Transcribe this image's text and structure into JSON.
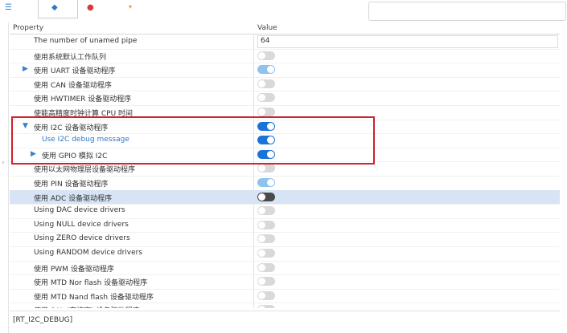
{
  "colors": {
    "accent": "#1a73d9",
    "selected_row": "#d6e4f5",
    "highlight_border": "#d0202a"
  },
  "toolbar": {
    "tabs": [
      {
        "icon": "list-icon"
      },
      {
        "icon": "shield-icon"
      },
      {
        "icon": "palette-icon"
      },
      {
        "icon": "bookmark-icon"
      }
    ],
    "search": {
      "placeholder": ""
    }
  },
  "table": {
    "headers": {
      "property": "Property",
      "value": "Value"
    },
    "rows": [
      {
        "label": "The number of unamed pipe",
        "type": "text",
        "value": "64"
      },
      {
        "label": "使用系统默认工作队列",
        "type": "toggle",
        "state": "off"
      },
      {
        "label": "使用 UART 设备驱动程序",
        "type": "toggle",
        "state": "on-light",
        "expander": true
      },
      {
        "label": "使用 CAN 设备驱动程序",
        "type": "toggle",
        "state": "off"
      },
      {
        "label": "使用 HWTIMER 设备驱动程序",
        "type": "toggle",
        "state": "off"
      },
      {
        "label": "使能高精度时钟计算 CPU 时间",
        "type": "toggle",
        "state": "off"
      },
      {
        "label": "使用 I2C 设备驱动程序",
        "type": "toggle",
        "state": "on",
        "expander": "open"
      },
      {
        "label": "Use I2C debug message",
        "type": "toggle",
        "state": "on",
        "child": true,
        "blue": true
      },
      {
        "label": "使用 GPIO 模拟 I2C",
        "type": "toggle",
        "state": "on",
        "child": true,
        "expander": true
      },
      {
        "label": "使用以太网物理层设备驱动程序",
        "type": "toggle",
        "state": "off"
      },
      {
        "label": "使用 PIN 设备驱动程序",
        "type": "toggle",
        "state": "on-light"
      },
      {
        "label": "使用 ADC 设备驱动程序",
        "type": "toggle",
        "state": "off-dark",
        "selected": true
      },
      {
        "label": "Using DAC device drivers",
        "type": "toggle",
        "state": "off"
      },
      {
        "label": "Using NULL device drivers",
        "type": "toggle",
        "state": "off"
      },
      {
        "label": "Using ZERO device drivers",
        "type": "toggle",
        "state": "off"
      },
      {
        "label": "Using RANDOM device drivers",
        "type": "toggle",
        "state": "off"
      },
      {
        "label": "使用 PWM 设备驱动程序",
        "type": "toggle",
        "state": "off"
      },
      {
        "label": "使用 MTD Nor flash 设备驱动程序",
        "type": "toggle",
        "state": "off"
      },
      {
        "label": "使用 MTD Nand flash 设备驱动程序",
        "type": "toggle",
        "state": "off"
      },
      {
        "label": "使用 SAL (套接字) 设备驱动程序",
        "type": "toggle",
        "state": "off"
      }
    ]
  },
  "status": {
    "text": "[RT_I2C_DEBUG]"
  }
}
